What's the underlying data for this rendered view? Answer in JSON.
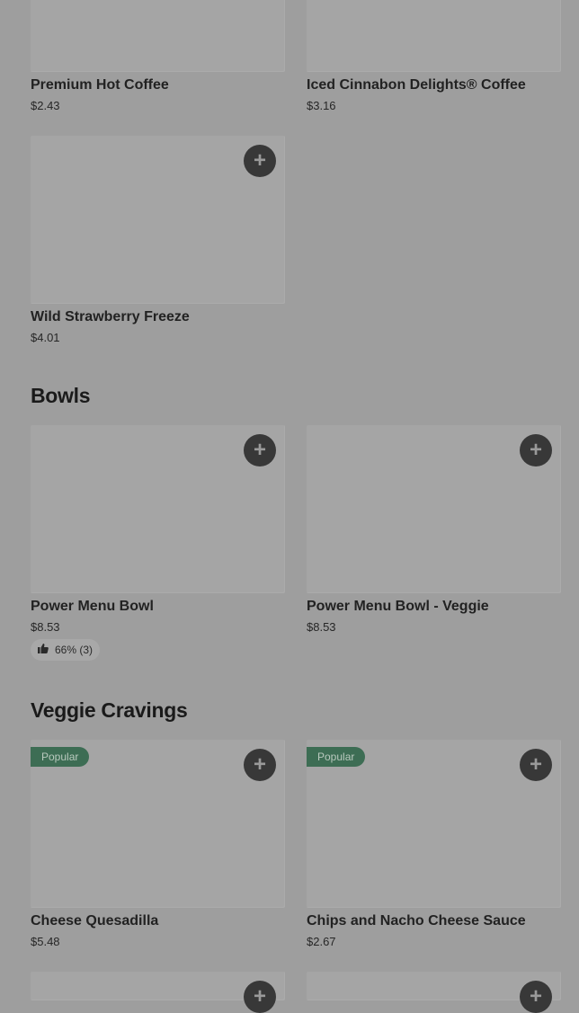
{
  "sections": [
    {
      "title": ""
    },
    {
      "title": "Bowls"
    },
    {
      "title": "Veggie Cravings"
    }
  ],
  "items": [
    {
      "name": "Premium Hot Coffee",
      "price": "$2.43"
    },
    {
      "name": "Iced Cinnabon Delights® Coffee",
      "price": "$3.16"
    },
    {
      "name": "Wild Strawberry Freeze",
      "price": "$4.01"
    },
    {
      "name": "Power Menu Bowl",
      "price": "$8.53",
      "rating": "66% (3)"
    },
    {
      "name": "Power Menu Bowl - Veggie",
      "price": "$8.53"
    },
    {
      "name": "Cheese Quesadilla",
      "price": "$5.48",
      "badge": "Popular"
    },
    {
      "name": "Chips and Nacho Cheese Sauce",
      "price": "$2.67",
      "badge": "Popular"
    }
  ],
  "add_symbol": "+",
  "icons": {
    "add": "plus-icon",
    "rating": "thumbs-up-icon"
  },
  "colors": {
    "overlay_bg": "#9e9e9e",
    "button": "#383838",
    "badge": "#3d6d54"
  }
}
